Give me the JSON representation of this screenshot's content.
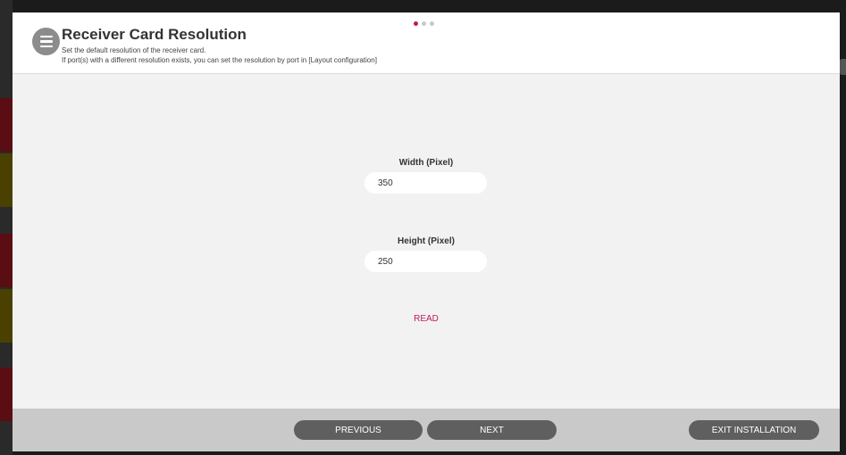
{
  "header": {
    "title": "Receiver Card Resolution",
    "description_line1": "Set the default resolution of the receiver card.",
    "description_line2": "If port(s) with a different resolution exists, you can set the resolution by port in [Layout configuration]",
    "step_indicator": {
      "total": 3,
      "current": 1
    }
  },
  "form": {
    "width_label": "Width (Pixel)",
    "width_value": "350",
    "height_label": "Height (Pixel)",
    "height_value": "250",
    "read_label": "READ"
  },
  "footer": {
    "previous_label": "PREVIOUS",
    "next_label": "NEXT",
    "exit_label": "EXIT INSTALLATION"
  },
  "colors": {
    "accent": "#c2185b",
    "button_bg": "#5f5f5f",
    "footer_bg": "#c9c9c9",
    "content_bg": "#f2f2f2"
  },
  "icons": {
    "menu": "hamburger-menu-icon"
  }
}
